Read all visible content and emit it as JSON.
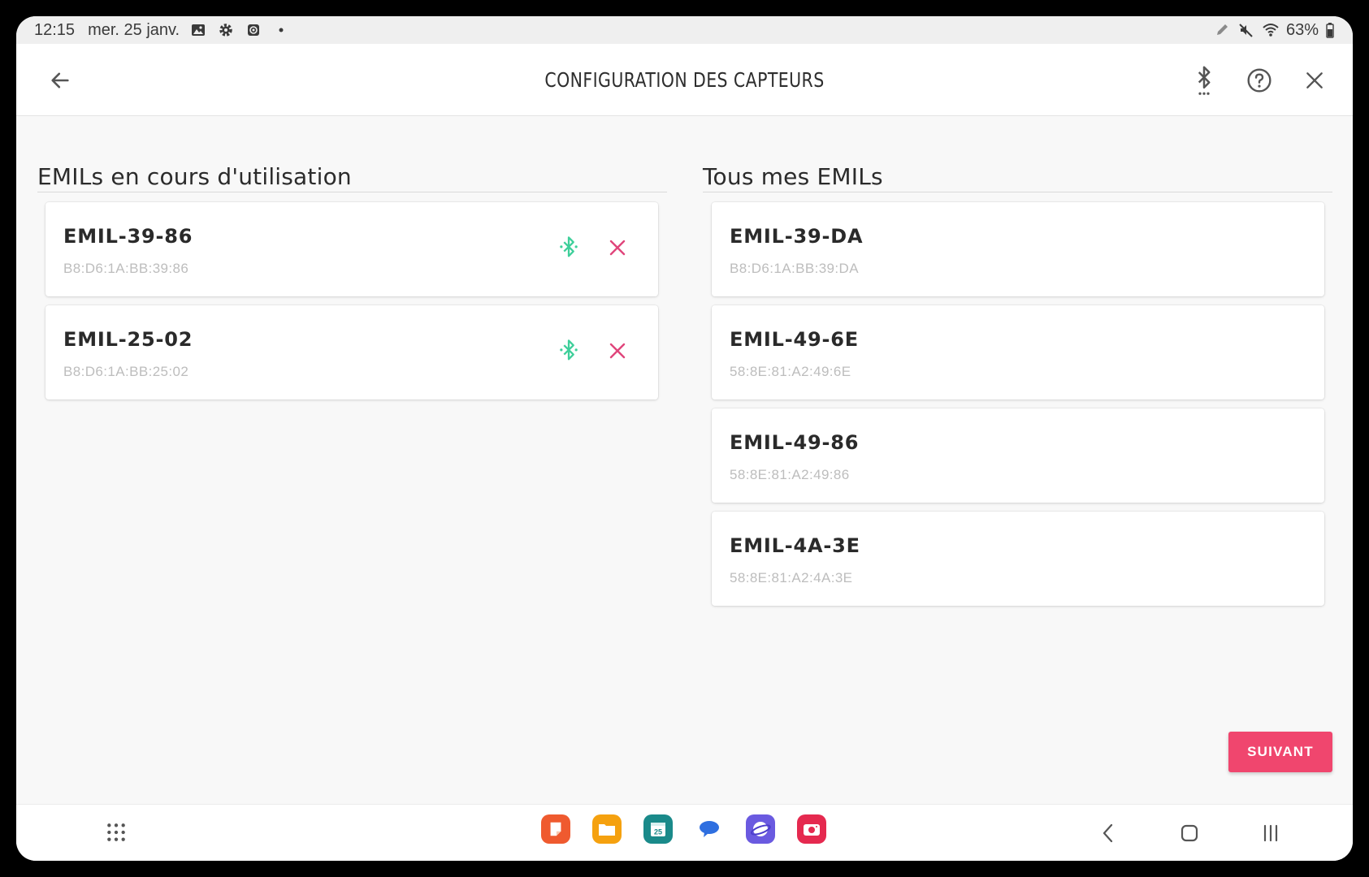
{
  "status_bar": {
    "time": "12:15",
    "date": "mer. 25 janv.",
    "battery": "63%"
  },
  "app_bar": {
    "title": "CONFIGURATION DES CAPTEURS"
  },
  "in_use": {
    "title": "EMILs en cours d'utilisation",
    "items": [
      {
        "name": "EMIL-39-86",
        "mac": "B8:D6:1A:BB:39:86"
      },
      {
        "name": "EMIL-25-02",
        "mac": "B8:D6:1A:BB:25:02"
      }
    ]
  },
  "all": {
    "title": "Tous mes EMILs",
    "items": [
      {
        "name": "EMIL-39-DA",
        "mac": "B8:D6:1A:BB:39:DA"
      },
      {
        "name": "EMIL-49-6E",
        "mac": "58:8E:81:A2:49:6E"
      },
      {
        "name": "EMIL-49-86",
        "mac": "58:8E:81:A2:49:86"
      },
      {
        "name": "EMIL-4A-3E",
        "mac": "58:8E:81:A2:4A:3E"
      }
    ]
  },
  "next_button": {
    "label": "SUIVANT"
  },
  "dock": {
    "calendar_day": "25"
  },
  "colors": {
    "accent": "#f0466e",
    "bluetooth_connected": "#3ecf9a",
    "remove": "#e0457b"
  }
}
